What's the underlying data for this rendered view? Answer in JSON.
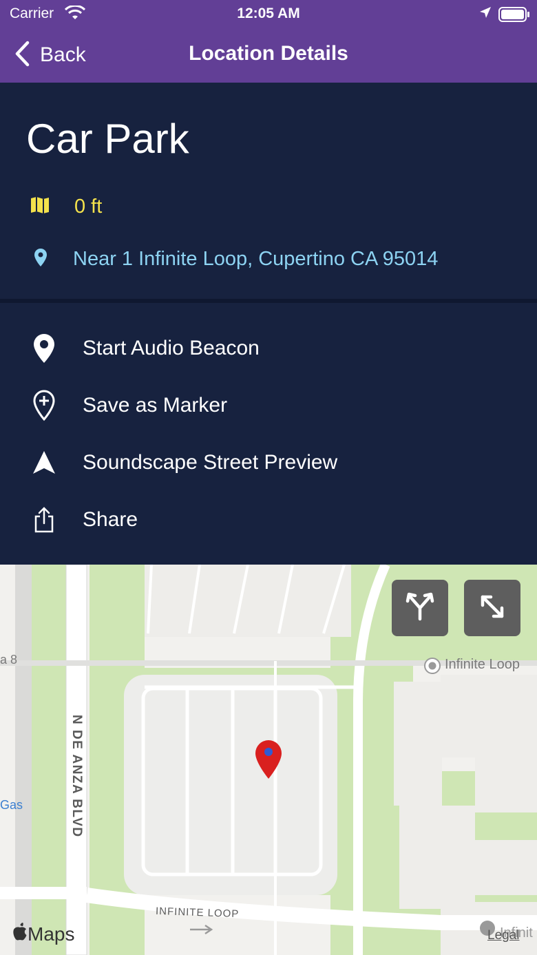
{
  "status_bar": {
    "carrier": "Carrier",
    "time": "12:05 AM"
  },
  "nav": {
    "back_label": "Back",
    "title": "Location Details"
  },
  "location": {
    "name": "Car Park",
    "distance": "0 ft",
    "address": "Near 1 Infinite Loop, Cupertino CA 95014"
  },
  "actions": [
    {
      "label": "Start Audio Beacon",
      "icon": "map-pin-icon"
    },
    {
      "label": "Save as Marker",
      "icon": "add-marker-icon"
    },
    {
      "label": "Soundscape Street Preview",
      "icon": "navigation-arrow-icon"
    },
    {
      "label": "Share",
      "icon": "share-icon"
    }
  ],
  "map": {
    "street_vertical": "N DE ANZA BLVD",
    "street_horizontal": "INFINITE LOOP",
    "poi_label": "Infinite Loop",
    "left_edge_label_1": "a 8",
    "left_edge_label_2": "Gas",
    "bottom_right_fragment": "Infinit",
    "attribution": "Maps",
    "legal": "Legal"
  },
  "colors": {
    "nav_bar": "#623F96",
    "background": "#17223F",
    "distance_text": "#F4E24C",
    "address_text": "#8DD3F2",
    "pin": "#D9201F"
  }
}
